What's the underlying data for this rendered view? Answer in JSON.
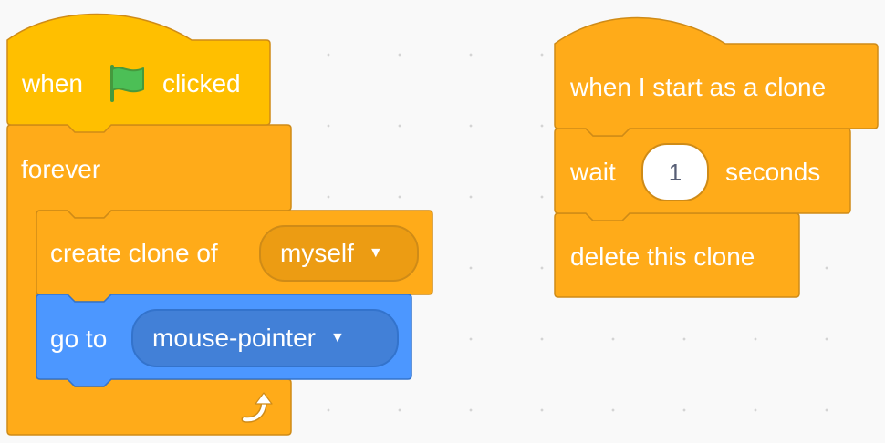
{
  "script_left": {
    "hat": {
      "text_when": "when",
      "flag_icon": "green-flag-icon",
      "text_clicked": "clicked"
    },
    "forever": {
      "label": "forever",
      "loop_icon": "loop-arrow-icon"
    },
    "create_clone": {
      "label": "create clone of",
      "menu_value": "myself"
    },
    "go_to": {
      "label": "go to",
      "menu_value": "mouse-pointer"
    }
  },
  "script_right": {
    "hat": {
      "label": "when I start as a clone"
    },
    "wait": {
      "label_before": "wait",
      "value": "1",
      "label_after": "seconds"
    },
    "delete": {
      "label": "delete this clone"
    }
  },
  "colors": {
    "events": "#ffbf00",
    "control": "#ffab19",
    "control_border": "#cf8b17",
    "control_field": "#ec9c13",
    "motion": "#4c97ff",
    "motion_border": "#3373cc",
    "motion_field": "#4280d7",
    "canvas": "#f9f9f9"
  }
}
